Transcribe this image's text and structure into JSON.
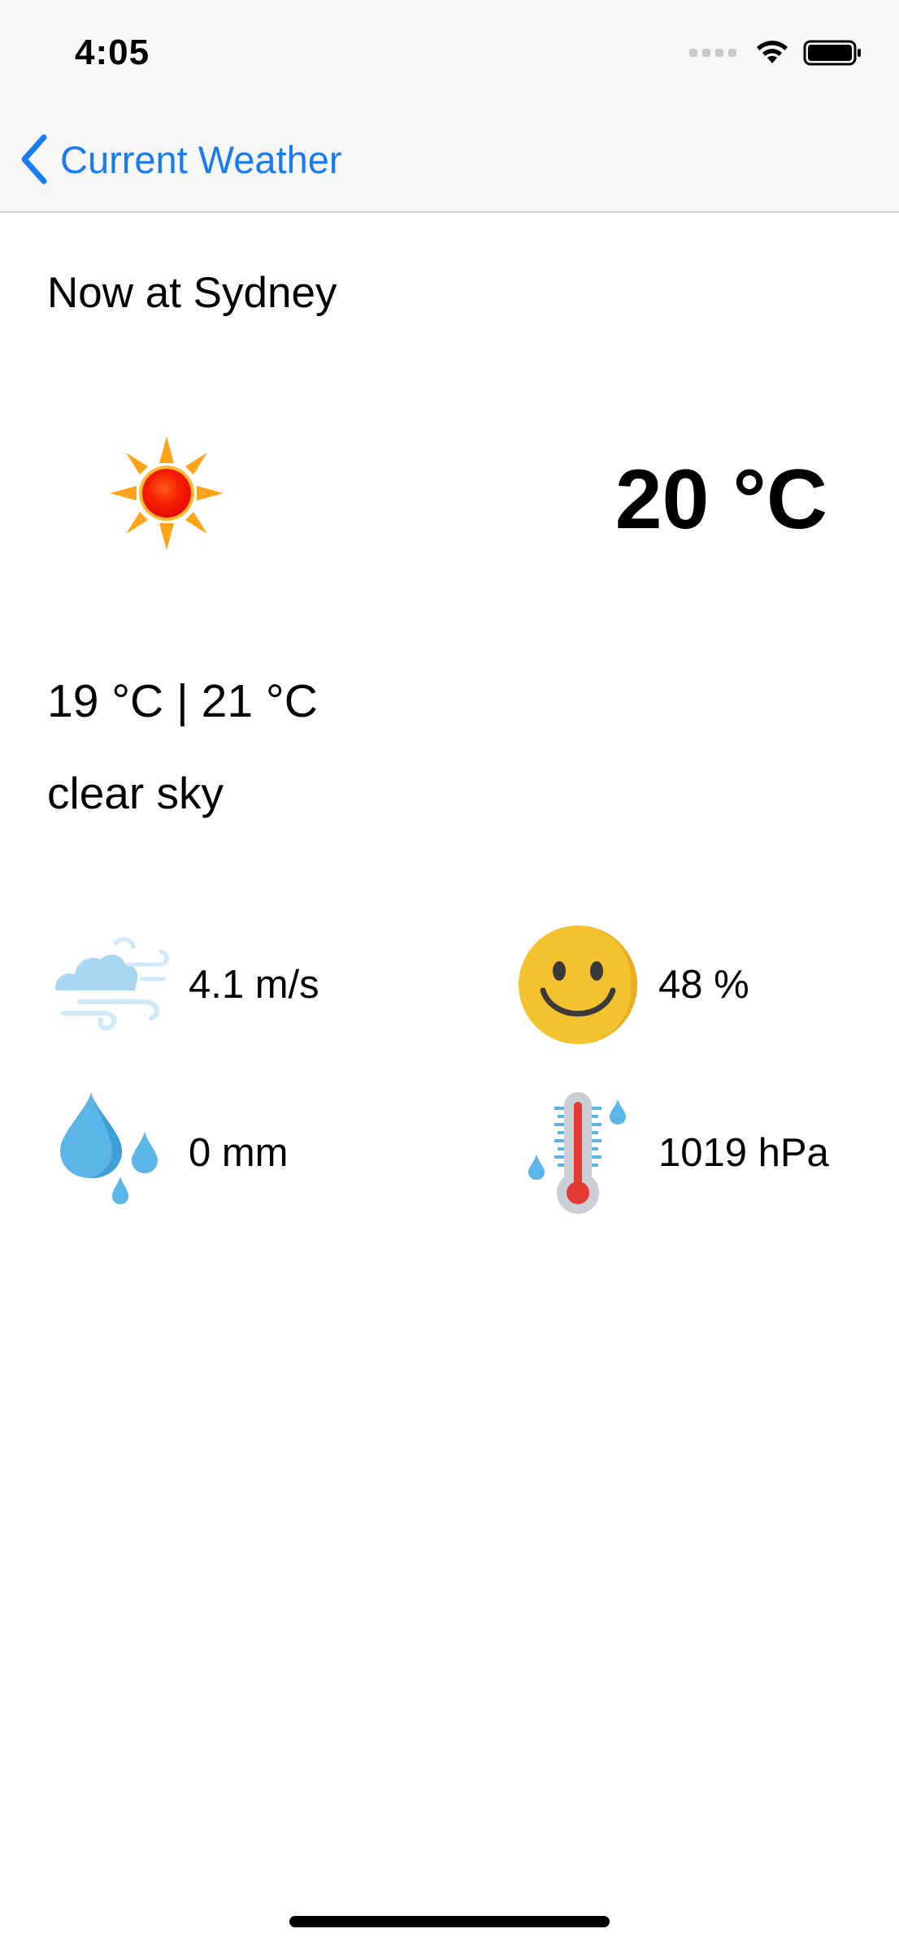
{
  "status_bar": {
    "time": "4:05"
  },
  "nav": {
    "back_label": "Current Weather"
  },
  "weather": {
    "location": "Now at Sydney",
    "current_temp": "20 °C",
    "min_max": "19 °C | 21 °C",
    "description": "clear sky",
    "condition_icon": "sun-icon"
  },
  "metrics": {
    "wind": {
      "value": "4.1 m/s",
      "icon": "wind-cloud-icon"
    },
    "humidity": {
      "value": "48 %",
      "icon": "smiley-face-icon"
    },
    "precipitation": {
      "value": "0 mm",
      "icon": "rain-drops-icon"
    },
    "pressure": {
      "value": "1019 hPa",
      "icon": "thermometer-icon"
    }
  },
  "colors": {
    "accent": "#1a7cf2",
    "nav_background": "#f7f7f7"
  }
}
